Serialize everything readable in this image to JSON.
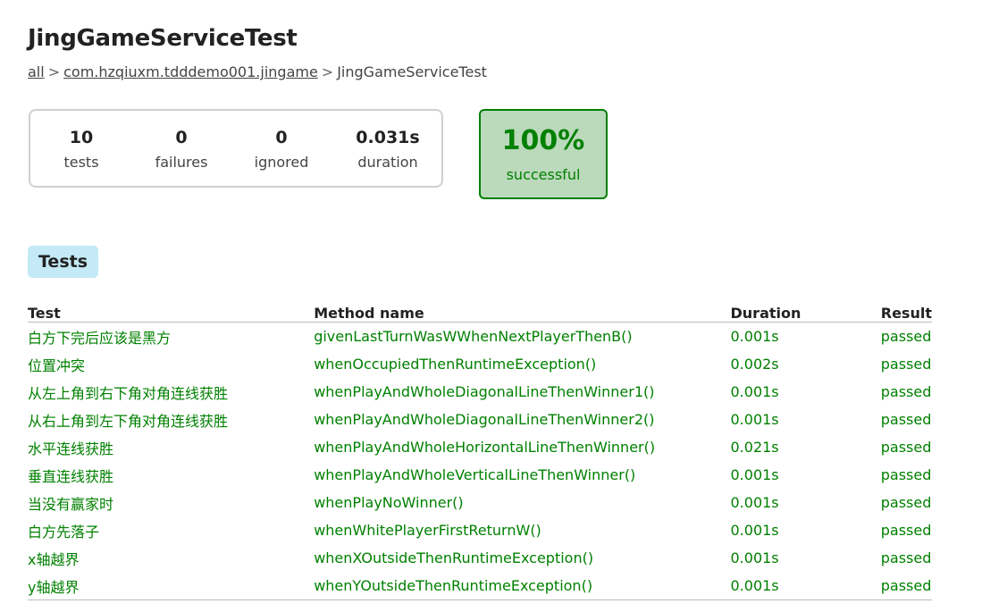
{
  "header": {
    "title": "JingGameServiceTest",
    "breadcrumb": {
      "root": "all",
      "separator": ">",
      "package": "com.hzqiuxm.tdddemo001.jingame",
      "current": "JingGameServiceTest"
    }
  },
  "summary": {
    "counters": [
      {
        "value": "10",
        "label": "tests"
      },
      {
        "value": "0",
        "label": "failures"
      },
      {
        "value": "0",
        "label": "ignored"
      },
      {
        "value": "0.031s",
        "label": "duration"
      }
    ],
    "success": {
      "percent": "100%",
      "label": "successful"
    }
  },
  "tabs": {
    "tests_label": "Tests"
  },
  "table": {
    "headers": {
      "test": "Test",
      "method": "Method name",
      "duration": "Duration",
      "result": "Result"
    },
    "rows": [
      {
        "test": "白方下完后应该是黑方",
        "method": "givenLastTurnWasWWhenNextPlayerThenB()",
        "duration": "0.001s",
        "result": "passed"
      },
      {
        "test": "位置冲突",
        "method": "whenOccupiedThenRuntimeException()",
        "duration": "0.002s",
        "result": "passed"
      },
      {
        "test": "从左上角到右下角对角连线获胜",
        "method": "whenPlayAndWholeDiagonalLineThenWinner1()",
        "duration": "0.001s",
        "result": "passed"
      },
      {
        "test": "从右上角到左下角对角连线获胜",
        "method": "whenPlayAndWholeDiagonalLineThenWinner2()",
        "duration": "0.001s",
        "result": "passed"
      },
      {
        "test": "水平连线获胜",
        "method": "whenPlayAndWholeHorizontalLineThenWinner()",
        "duration": "0.021s",
        "result": "passed"
      },
      {
        "test": "垂直连线获胜",
        "method": "whenPlayAndWholeVerticalLineThenWinner()",
        "duration": "0.001s",
        "result": "passed"
      },
      {
        "test": "当没有赢家时",
        "method": "whenPlayNoWinner()",
        "duration": "0.001s",
        "result": "passed"
      },
      {
        "test": "白方先落子",
        "method": "whenWhitePlayerFirstReturnW()",
        "duration": "0.001s",
        "result": "passed"
      },
      {
        "test": "x轴越界",
        "method": "whenXOutsideThenRuntimeException()",
        "duration": "0.001s",
        "result": "passed"
      },
      {
        "test": "y轴越界",
        "method": "whenYOutsideThenRuntimeException()",
        "duration": "0.001s",
        "result": "passed"
      }
    ]
  },
  "colors": {
    "success_green": "#008000",
    "success_bg": "#bbd9bb",
    "tab_bg": "#c3eaf6",
    "border_gray": "#d0d0d0"
  }
}
